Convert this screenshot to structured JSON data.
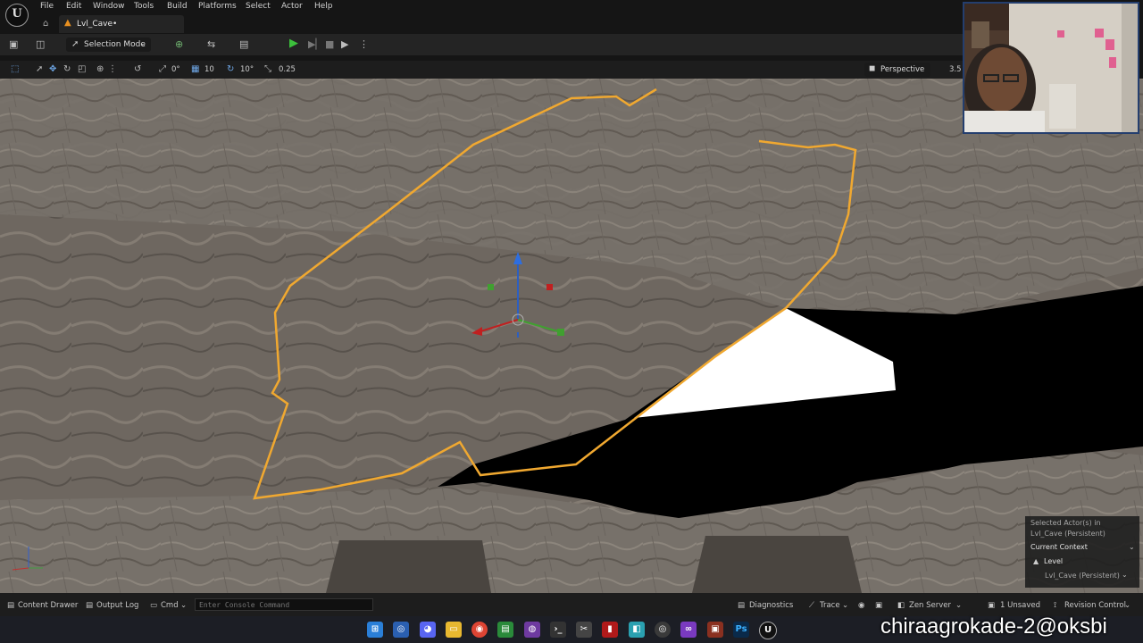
{
  "menu": [
    "File",
    "Edit",
    "Window",
    "Tools",
    "Build",
    "Platforms",
    "Select",
    "Actor",
    "Help"
  ],
  "level_tab": {
    "label": "Lvl_Cave•"
  },
  "toolbar": {
    "selection_mode": "Selection Mode"
  },
  "viewport_toolbar": {
    "rotate_snap_left": "0°",
    "grid_snap": "10",
    "rotation_snap": "10°",
    "scale_snap": "0.25",
    "view_mode": "Perspective",
    "fov": "3.5"
  },
  "details_overlay": {
    "selected_line1": "Selected Actor(s) in",
    "selected_line2": "Lvl_Cave (Persistent)",
    "context_title": "Current Context",
    "level_label": "Level",
    "level_value": "Lvl_Cave (Persistent)"
  },
  "bottom_bar": {
    "content_drawer": "Content Drawer",
    "output_log": "Output Log",
    "cmd": "Cmd",
    "console_placeholder": "Enter Console Command",
    "diagnostics": "Diagnostics",
    "trace": "Trace",
    "zen_server": "Zen Server",
    "unsaved": "1 Unsaved",
    "revision_control": "Revision Control"
  },
  "watermark": "chiraagrokade-2@oksbi",
  "colors": {
    "accent_orange": "#f0a830",
    "play_green": "#3cc03c",
    "webcam_border": "#243e6e"
  }
}
